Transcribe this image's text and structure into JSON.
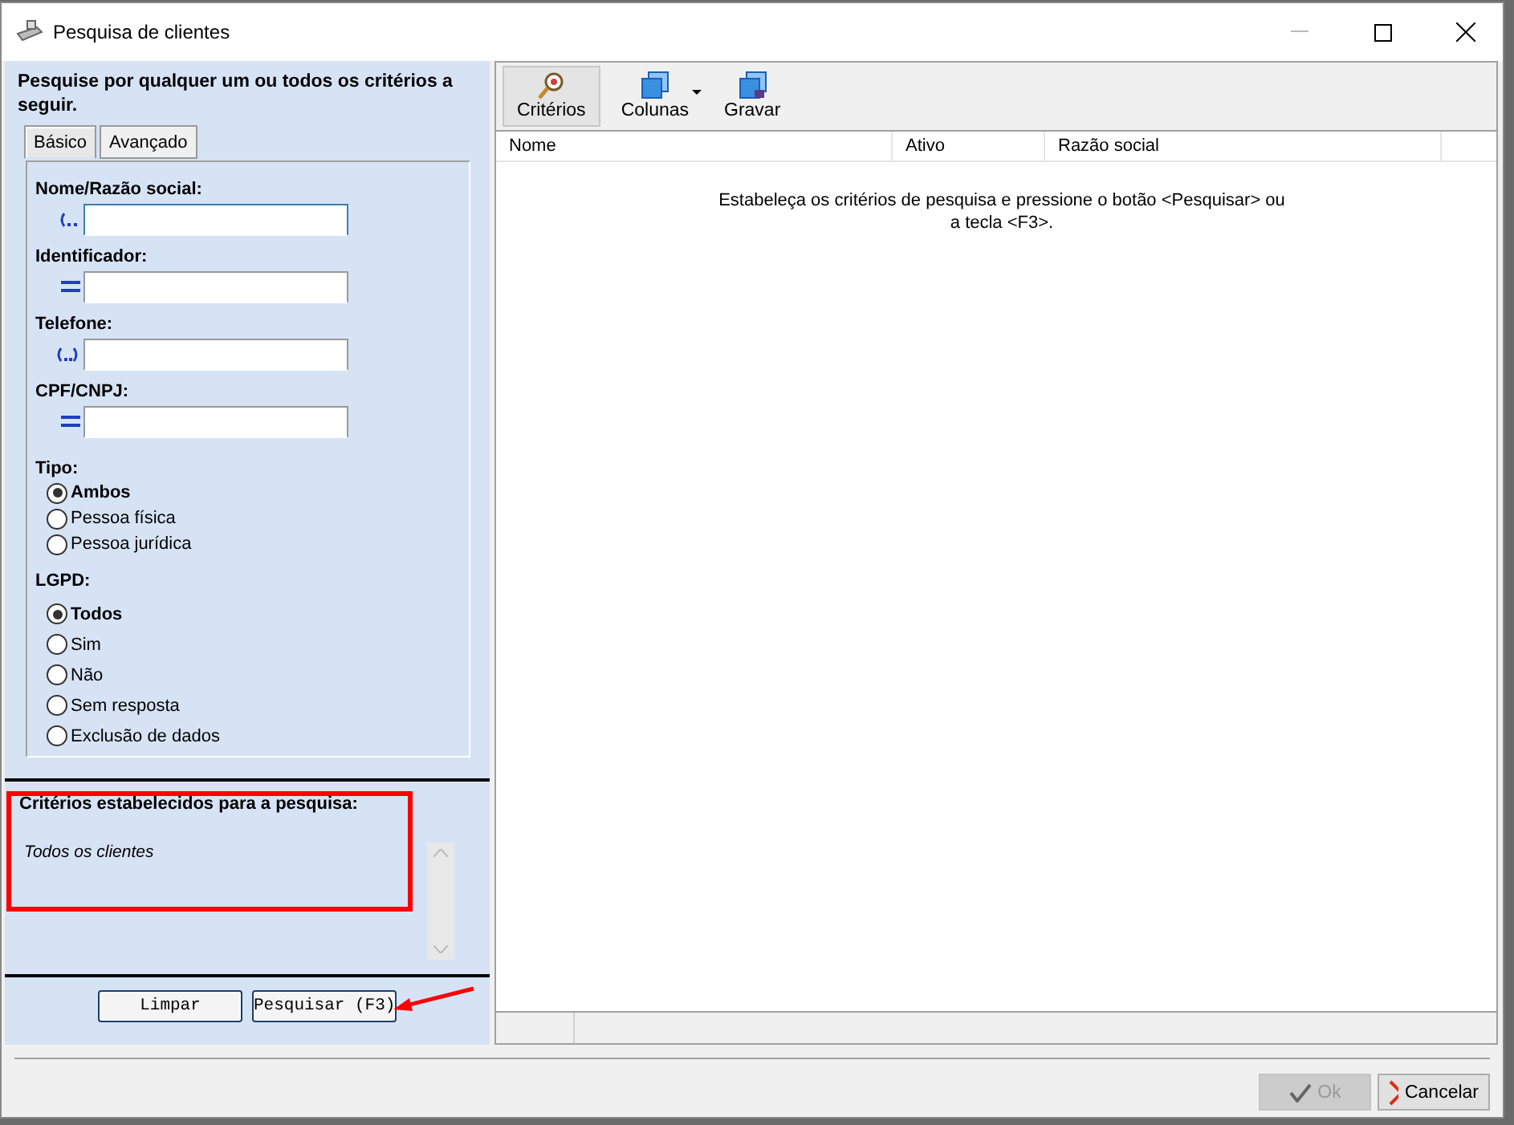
{
  "window": {
    "title": "Pesquisa de clientes"
  },
  "search_panel": {
    "heading": "Pesquise por qualquer um ou todos os critérios a seguir.",
    "tabs": [
      {
        "label": "Básico",
        "selected": true
      },
      {
        "label": "Avançado",
        "selected": false
      }
    ],
    "fields": [
      {
        "label": "Nome/Razão social:",
        "kind": "contains",
        "focused": true
      },
      {
        "label": "Identificador:",
        "kind": "equals",
        "focused": false
      },
      {
        "label": "Telefone:",
        "kind": "around",
        "focused": false
      },
      {
        "label": "CPF/CNPJ:",
        "kind": "equals",
        "focused": false
      }
    ],
    "radio_groups": [
      {
        "label": "Tipo:",
        "options": [
          {
            "label": "Ambos",
            "selected": true
          },
          {
            "label": "Pessoa física",
            "selected": false
          },
          {
            "label": "Pessoa jurídica",
            "selected": false
          }
        ]
      },
      {
        "label": "LGPD:",
        "options": [
          {
            "label": "Todos",
            "selected": true
          },
          {
            "label": "Sim",
            "selected": false
          },
          {
            "label": "Não",
            "selected": false
          },
          {
            "label": "Sem resposta",
            "selected": false
          },
          {
            "label": "Exclusão de dados",
            "selected": false
          }
        ]
      }
    ],
    "criteria_title": "Critérios estabelecidos para a pesquisa:",
    "criteria_text": "Todos os clientes",
    "buttons": [
      {
        "label": "Limpar"
      },
      {
        "label": "Pesquisar (F3)"
      }
    ]
  },
  "toolbar": [
    {
      "label": "Critérios",
      "kind": "search",
      "selected": true,
      "dropdown": false
    },
    {
      "label": "Colunas",
      "kind": "columns",
      "selected": false,
      "dropdown": true
    },
    {
      "label": "Gravar",
      "kind": "save",
      "selected": false,
      "dropdown": false
    }
  ],
  "table": {
    "columns": [
      "Nome",
      "Ativo",
      "Razão social"
    ],
    "empty_message": "Estabeleça os critérios de pesquisa e pressione o botão <Pesquisar> ou a tecla <F3>."
  },
  "footer_buttons": [
    {
      "label": "Ok",
      "kind": "ok",
      "disabled": true
    },
    {
      "label": "Cancelar",
      "kind": "cancel",
      "disabled": false
    }
  ]
}
